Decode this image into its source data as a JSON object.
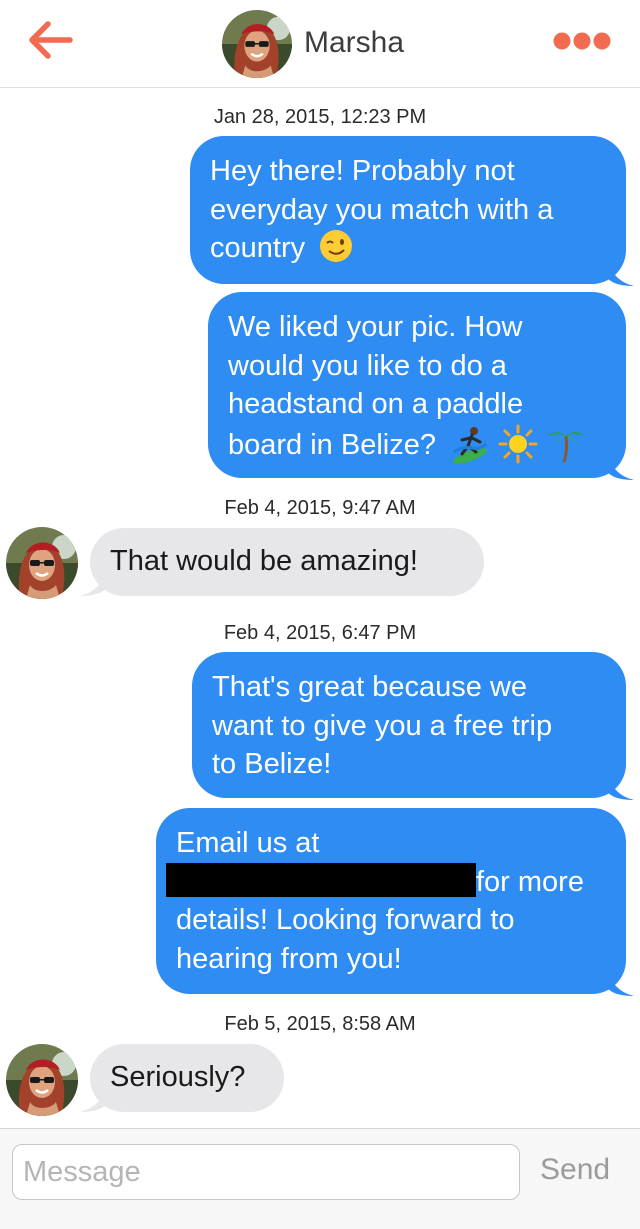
{
  "header": {
    "back_icon": "back-arrow-icon",
    "contact_name": "Marsha",
    "more_icon": "more-dots-icon",
    "accent_color": "#f26a4f"
  },
  "thread": [
    {
      "type": "timestamp",
      "text": "Jan 28, 2015, 12:23 PM"
    },
    {
      "type": "message",
      "direction": "outgoing",
      "lines": [
        "Hey there! Probably not",
        "everyday you match with a",
        "country"
      ],
      "emoji": [
        "winking-face-icon"
      ]
    },
    {
      "type": "message",
      "direction": "outgoing",
      "lines": [
        "We liked your pic. How",
        "would you like to do a",
        "headstand on a paddle",
        "board in Belize?"
      ],
      "emoji": [
        "surfer-icon",
        "sun-icon",
        "palm-tree-icon"
      ]
    },
    {
      "type": "timestamp",
      "text": "Feb 4, 2015, 9:47 AM"
    },
    {
      "type": "message",
      "direction": "incoming",
      "lines": [
        "That would be amazing!"
      ]
    },
    {
      "type": "timestamp",
      "text": "Feb 4, 2015, 6:47 PM"
    },
    {
      "type": "message",
      "direction": "outgoing",
      "lines": [
        "That's great because we",
        "want to give you a free trip",
        "to Belize!"
      ]
    },
    {
      "type": "message",
      "direction": "outgoing",
      "lines": [
        "Email us at",
        "for more",
        "details! Looking forward to",
        "hearing from you!"
      ],
      "redacted": true
    },
    {
      "type": "timestamp",
      "text": "Feb 5, 2015, 8:58 AM"
    },
    {
      "type": "message",
      "direction": "incoming",
      "lines": [
        "Seriously?"
      ]
    }
  ],
  "composer": {
    "placeholder": "Message",
    "value": "",
    "send_label": "Send"
  },
  "colors": {
    "outgoing_bubble": "#2e8cf3",
    "incoming_bubble": "#e7e7ea"
  }
}
